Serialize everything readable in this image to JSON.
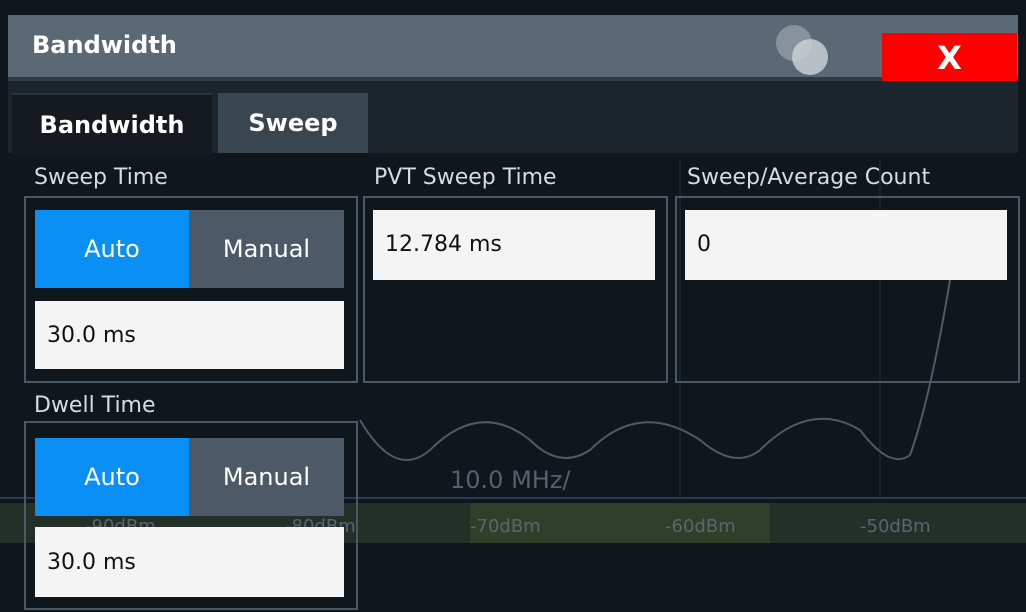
{
  "dialog": {
    "title": "Bandwidth",
    "close_label": "X"
  },
  "tabs": [
    {
      "label": "Bandwidth",
      "active": false
    },
    {
      "label": "Sweep",
      "active": true
    }
  ],
  "sweep_time": {
    "label": "Sweep Time",
    "auto_label": "Auto",
    "manual_label": "Manual",
    "selected": "Auto",
    "value": "30.0 ms"
  },
  "pvt_sweep_time": {
    "label": "PVT Sweep Time",
    "value": "12.784 ms"
  },
  "sweep_average_count": {
    "label": "Sweep/Average Count",
    "value": "0"
  },
  "dwell_time": {
    "label": "Dwell Time",
    "auto_label": "Auto",
    "manual_label": "Manual",
    "selected": "Auto",
    "value": "30.0 ms"
  },
  "background": {
    "scale_label": "10.0 MHz/",
    "db_labels": [
      "-90dBm",
      "-80dBm",
      "-70dBm",
      "-60dBm",
      "-50dBm"
    ]
  },
  "colors": {
    "title_bar": "#5b6876",
    "close_button": "#ff0000",
    "selected_option": "#0a8ff5",
    "active_tab": "#39454f"
  }
}
